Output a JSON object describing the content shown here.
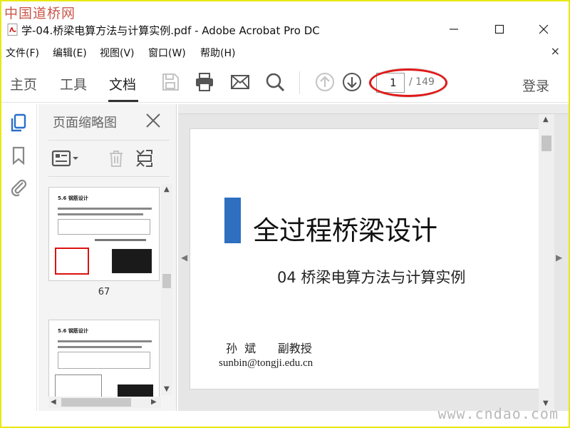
{
  "watermark": {
    "top": "中国道桥网",
    "bottom": "www.cndao.com"
  },
  "window": {
    "title": "学-04.桥梁电算方法与计算实例.pdf - Adobe Acrobat Pro DC"
  },
  "menu": {
    "items": [
      {
        "label": "文件(F)"
      },
      {
        "label": "编辑(E)"
      },
      {
        "label": "视图(V)"
      },
      {
        "label": "窗口(W)"
      },
      {
        "label": "帮助(H)"
      }
    ],
    "close": "×"
  },
  "toolbar": {
    "tabs": [
      {
        "label": "主页"
      },
      {
        "label": "工具"
      },
      {
        "label": "文档"
      }
    ],
    "active_tab": "文档",
    "page_current": "1",
    "page_total": "/ 149",
    "login": "登录"
  },
  "panel": {
    "title": "页面缩略图",
    "thumbnails": [
      {
        "heading": "5.6 钢筋设计",
        "page_number": "67"
      },
      {
        "heading": "5.6 钢筋设计",
        "page_number": ""
      }
    ]
  },
  "document": {
    "title": "全过程桥梁设计",
    "subtitle": "04 桥梁电算方法与计算实例",
    "author": "孙  斌      副教授",
    "email": "sunbin@tongji.edu.cn"
  },
  "colors": {
    "accent_blue": "#2e6fbf",
    "highlight_red": "#e01818",
    "frame_yellow": "#e8e813"
  }
}
